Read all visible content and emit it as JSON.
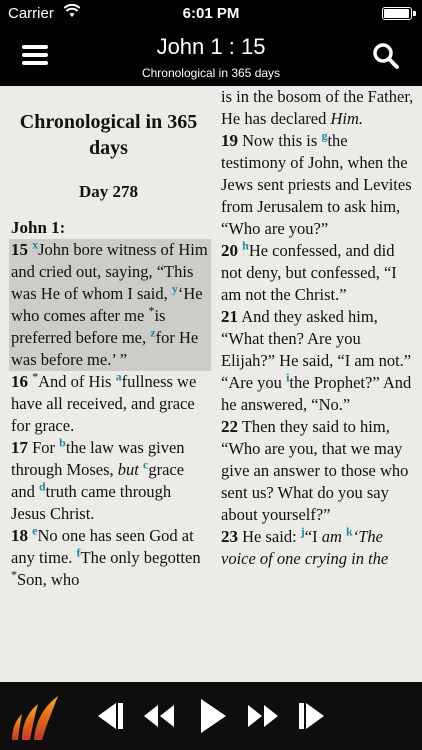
{
  "status": {
    "carrier": "Carrier",
    "time": "6:01 PM",
    "battery_level": 0.95
  },
  "nav": {
    "title": "John 1 : 15",
    "subtitle": "Chronological in 365 days"
  },
  "reading": {
    "heading": "Chronological in 365 days",
    "day": "Day 278",
    "book": "John 1:",
    "top_tail": "is in the bosom of the Father, He has declared",
    "top_tail_italic": "Him."
  },
  "verses": {
    "v15": {
      "num": "15",
      "fn1": "x",
      "t1": "John bore witness of Him and cried out, saying, “This was He of whom I said,",
      "fn2": "y",
      "t2": "‘He who comes after me",
      "ast": "*",
      "t3": "is preferred before me,",
      "fn3": "z",
      "t4": "for He was before me.’ ”"
    },
    "v16": {
      "num": "16",
      "ast": "*",
      "t1": "And of His",
      "fn1": "a",
      "t2": "fullness we have all received, and grace for grace."
    },
    "v17": {
      "num": "17",
      "t1": "For",
      "fn1": "b",
      "t2": "the law was given through Moses,",
      "t3_italic": "but",
      "fn2": "c",
      "t4": "grace and",
      "fn3": "d",
      "t5": "truth came through Jesus Christ."
    },
    "v18": {
      "num": "18",
      "fn1": "e",
      "t1": "No one has seen God at any time.",
      "fn2": "f",
      "t2": "The only begotten",
      "ast": "*",
      "t3": "Son, who"
    },
    "v19": {
      "num": "19",
      "t1": "Now this is",
      "fn1": "g",
      "t2": "the testimony of John, when the Jews sent priests and Levites from Jerusalem to ask him, “Who are you?”"
    },
    "v20": {
      "num": "20",
      "fn1": "h",
      "t1": "He confessed, and did not deny, but confessed, “I am not the Christ.”"
    },
    "v21": {
      "num": "21",
      "t1": "And they asked him, “What then? Are you Elijah?” He said, “I am not.” “Are you",
      "fn1": "i",
      "t2": "the Prophet?” And he answered, “No.”"
    },
    "v22": {
      "num": "22",
      "t1": "Then they said to him, “Who are you, that we may give an answer to those who sent us? What do you say about yourself?”"
    },
    "v23": {
      "num": "23",
      "t1": "He said:",
      "fn1": "j",
      "t2": "“I",
      "t2_italic": "am",
      "fn2": "k",
      "t3_italic": "‘The voice of one crying in the"
    }
  },
  "player": {
    "logo_icon": "flame-logo-icon",
    "controls": [
      "skip-back-icon",
      "rewind-icon",
      "play-icon",
      "fast-forward-icon",
      "skip-forward-icon"
    ]
  }
}
